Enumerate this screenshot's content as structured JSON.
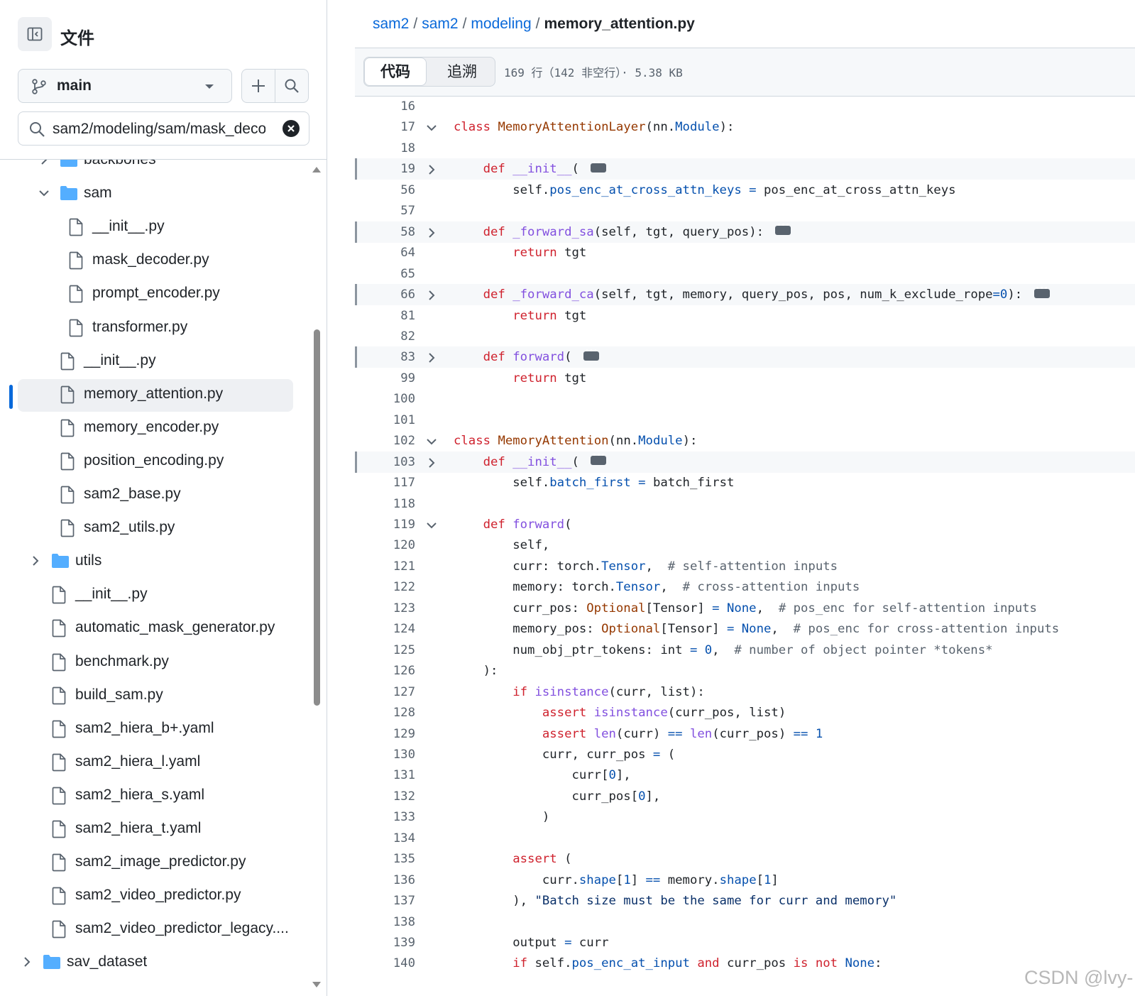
{
  "sidebar": {
    "title": "文件",
    "branch": "main",
    "path_filter": "sam2/modeling/sam/mask_deco",
    "tree": [
      {
        "label": "backbones",
        "type": "folder",
        "expanded": false,
        "depth": 1
      },
      {
        "label": "sam",
        "type": "folder",
        "expanded": true,
        "depth": 1
      },
      {
        "label": "__init__.py",
        "type": "file",
        "depth": 2
      },
      {
        "label": "mask_decoder.py",
        "type": "file",
        "depth": 2
      },
      {
        "label": "prompt_encoder.py",
        "type": "file",
        "depth": 2
      },
      {
        "label": "transformer.py",
        "type": "file",
        "depth": 2
      },
      {
        "label": "__init__.py",
        "type": "file",
        "depth": 1
      },
      {
        "label": "memory_attention.py",
        "type": "file",
        "depth": 1,
        "selected": true
      },
      {
        "label": "memory_encoder.py",
        "type": "file",
        "depth": 1
      },
      {
        "label": "position_encoding.py",
        "type": "file",
        "depth": 1
      },
      {
        "label": "sam2_base.py",
        "type": "file",
        "depth": 1
      },
      {
        "label": "sam2_utils.py",
        "type": "file",
        "depth": 1
      },
      {
        "label": "utils",
        "type": "folder",
        "expanded": false,
        "depth": 0
      },
      {
        "label": "__init__.py",
        "type": "file",
        "depth": 0
      },
      {
        "label": "automatic_mask_generator.py",
        "type": "file",
        "depth": 0
      },
      {
        "label": "benchmark.py",
        "type": "file",
        "depth": 0
      },
      {
        "label": "build_sam.py",
        "type": "file",
        "depth": 0
      },
      {
        "label": "sam2_hiera_b+.yaml",
        "type": "file",
        "depth": 0
      },
      {
        "label": "sam2_hiera_l.yaml",
        "type": "file",
        "depth": 0
      },
      {
        "label": "sam2_hiera_s.yaml",
        "type": "file",
        "depth": 0
      },
      {
        "label": "sam2_hiera_t.yaml",
        "type": "file",
        "depth": 0
      },
      {
        "label": "sam2_image_predictor.py",
        "type": "file",
        "depth": 0
      },
      {
        "label": "sam2_video_predictor.py",
        "type": "file",
        "depth": 0
      },
      {
        "label": "sam2_video_predictor_legacy....",
        "type": "file",
        "depth": 0
      },
      {
        "label": "sav_dataset",
        "type": "folder",
        "expanded": false,
        "depth": -1
      }
    ]
  },
  "breadcrumb": {
    "parts": [
      "sam2",
      "sam2",
      "modeling"
    ],
    "separator": "/",
    "current": "memory_attention.py"
  },
  "toolbar": {
    "tab_code": "代码",
    "tab_blame": "追溯",
    "file_info": "169 行（142 非空行）· 5.38 KB"
  },
  "code": {
    "lines": [
      {
        "n": "16",
        "fold": "",
        "tokens": []
      },
      {
        "n": "17",
        "fold": "down",
        "tokens": [
          [
            "k",
            "class "
          ],
          [
            "t",
            "MemoryAttentionLayer"
          ],
          [
            "",
            "(nn."
          ],
          [
            "n",
            "Module"
          ],
          [
            "",
            "):"
          ]
        ]
      },
      {
        "n": "18",
        "fold": "",
        "tokens": []
      },
      {
        "n": "19",
        "fold": "right",
        "collapsed": true,
        "tokens": [
          [
            "",
            "    "
          ],
          [
            "k",
            "def "
          ],
          [
            "f",
            "__init__"
          ],
          [
            "",
            "( "
          ]
        ]
      },
      {
        "n": "56",
        "fold": "",
        "tokens": [
          [
            "",
            "        self."
          ],
          [
            "n",
            "pos_enc_at_cross_attn_keys"
          ],
          [
            "n",
            " = "
          ],
          [
            "",
            "pos_enc_at_cross_attn_keys"
          ]
        ]
      },
      {
        "n": "57",
        "fold": "",
        "tokens": []
      },
      {
        "n": "58",
        "fold": "right",
        "collapsed": true,
        "tokens": [
          [
            "",
            "    "
          ],
          [
            "k",
            "def "
          ],
          [
            "f",
            "_forward_sa"
          ],
          [
            "",
            "(self, tgt, query_pos): "
          ]
        ]
      },
      {
        "n": "64",
        "fold": "",
        "tokens": [
          [
            "",
            "        "
          ],
          [
            "k",
            "return"
          ],
          [
            "",
            " tgt"
          ]
        ]
      },
      {
        "n": "65",
        "fold": "",
        "tokens": []
      },
      {
        "n": "66",
        "fold": "right",
        "collapsed": true,
        "tokens": [
          [
            "",
            "    "
          ],
          [
            "k",
            "def "
          ],
          [
            "f",
            "_forward_ca"
          ],
          [
            "",
            "(self, tgt, memory, query_pos, pos, num_k_exclude_rope"
          ],
          [
            "n",
            "=0"
          ],
          [
            "",
            "): "
          ]
        ]
      },
      {
        "n": "81",
        "fold": "",
        "tokens": [
          [
            "",
            "        "
          ],
          [
            "k",
            "return"
          ],
          [
            "",
            " tgt"
          ]
        ]
      },
      {
        "n": "82",
        "fold": "",
        "tokens": []
      },
      {
        "n": "83",
        "fold": "right",
        "collapsed": true,
        "tokens": [
          [
            "",
            "    "
          ],
          [
            "k",
            "def "
          ],
          [
            "f",
            "forward"
          ],
          [
            "",
            "( "
          ]
        ]
      },
      {
        "n": "99",
        "fold": "",
        "tokens": [
          [
            "",
            "        "
          ],
          [
            "k",
            "return"
          ],
          [
            "",
            " tgt"
          ]
        ]
      },
      {
        "n": "100",
        "fold": "",
        "tokens": []
      },
      {
        "n": "101",
        "fold": "",
        "tokens": []
      },
      {
        "n": "102",
        "fold": "down",
        "tokens": [
          [
            "k",
            "class "
          ],
          [
            "t",
            "MemoryAttention"
          ],
          [
            "",
            "(nn."
          ],
          [
            "n",
            "Module"
          ],
          [
            "",
            "):"
          ]
        ]
      },
      {
        "n": "103",
        "fold": "right",
        "collapsed": true,
        "tokens": [
          [
            "",
            "    "
          ],
          [
            "k",
            "def "
          ],
          [
            "f",
            "__init__"
          ],
          [
            "",
            "( "
          ]
        ]
      },
      {
        "n": "117",
        "fold": "",
        "tokens": [
          [
            "",
            "        self."
          ],
          [
            "n",
            "batch_first"
          ],
          [
            "n",
            " = "
          ],
          [
            "",
            "batch_first"
          ]
        ]
      },
      {
        "n": "118",
        "fold": "",
        "tokens": []
      },
      {
        "n": "119",
        "fold": "down",
        "tokens": [
          [
            "",
            "    "
          ],
          [
            "k",
            "def "
          ],
          [
            "f",
            "forward"
          ],
          [
            "",
            "("
          ]
        ]
      },
      {
        "n": "120",
        "fold": "",
        "tokens": [
          [
            "",
            "        self,"
          ]
        ]
      },
      {
        "n": "121",
        "fold": "",
        "tokens": [
          [
            "",
            "        curr: torch."
          ],
          [
            "n",
            "Tensor"
          ],
          [
            "",
            ",  "
          ],
          [
            "c",
            "# self-attention inputs"
          ]
        ]
      },
      {
        "n": "122",
        "fold": "",
        "tokens": [
          [
            "",
            "        memory: torch."
          ],
          [
            "n",
            "Tensor"
          ],
          [
            "",
            ",  "
          ],
          [
            "c",
            "# cross-attention inputs"
          ]
        ]
      },
      {
        "n": "123",
        "fold": "",
        "tokens": [
          [
            "",
            "        curr_pos: "
          ],
          [
            "t",
            "Optional"
          ],
          [
            "",
            "[Tensor] "
          ],
          [
            "n",
            "= None"
          ],
          [
            "",
            ",  "
          ],
          [
            "c",
            "# pos_enc for self-attention inputs"
          ]
        ]
      },
      {
        "n": "124",
        "fold": "",
        "tokens": [
          [
            "",
            "        memory_pos: "
          ],
          [
            "t",
            "Optional"
          ],
          [
            "",
            "[Tensor] "
          ],
          [
            "n",
            "= None"
          ],
          [
            "",
            ",  "
          ],
          [
            "c",
            "# pos_enc for cross-attention inputs"
          ]
        ]
      },
      {
        "n": "125",
        "fold": "",
        "tokens": [
          [
            "",
            "        num_obj_ptr_tokens: int "
          ],
          [
            "n",
            "= 0"
          ],
          [
            "",
            ",  "
          ],
          [
            "c",
            "# number of object pointer *tokens*"
          ]
        ]
      },
      {
        "n": "126",
        "fold": "",
        "tokens": [
          [
            "",
            "    ):"
          ]
        ]
      },
      {
        "n": "127",
        "fold": "",
        "tokens": [
          [
            "",
            "        "
          ],
          [
            "k",
            "if "
          ],
          [
            "f",
            "isinstance"
          ],
          [
            "",
            "(curr, list):"
          ]
        ]
      },
      {
        "n": "128",
        "fold": "",
        "tokens": [
          [
            "",
            "            "
          ],
          [
            "k",
            "assert "
          ],
          [
            "f",
            "isinstance"
          ],
          [
            "",
            "(curr_pos, list)"
          ]
        ]
      },
      {
        "n": "129",
        "fold": "",
        "tokens": [
          [
            "",
            "            "
          ],
          [
            "k",
            "assert "
          ],
          [
            "f",
            "len"
          ],
          [
            "",
            "(curr) "
          ],
          [
            "n",
            "=="
          ],
          [
            "",
            " "
          ],
          [
            "f",
            "len"
          ],
          [
            "",
            "(curr_pos) "
          ],
          [
            "n",
            "== 1"
          ]
        ]
      },
      {
        "n": "130",
        "fold": "",
        "tokens": [
          [
            "",
            "            curr, curr_pos "
          ],
          [
            "n",
            "="
          ],
          [
            "",
            " ("
          ]
        ]
      },
      {
        "n": "131",
        "fold": "",
        "tokens": [
          [
            "",
            "                curr["
          ],
          [
            "n",
            "0"
          ],
          [
            "",
            "],"
          ]
        ]
      },
      {
        "n": "132",
        "fold": "",
        "tokens": [
          [
            "",
            "                curr_pos["
          ],
          [
            "n",
            "0"
          ],
          [
            "",
            "],"
          ]
        ]
      },
      {
        "n": "133",
        "fold": "",
        "tokens": [
          [
            "",
            "            )"
          ]
        ]
      },
      {
        "n": "134",
        "fold": "",
        "tokens": []
      },
      {
        "n": "135",
        "fold": "",
        "tokens": [
          [
            "",
            "        "
          ],
          [
            "k",
            "assert"
          ],
          [
            "",
            " ("
          ]
        ]
      },
      {
        "n": "136",
        "fold": "",
        "tokens": [
          [
            "",
            "            curr."
          ],
          [
            "n",
            "shape"
          ],
          [
            "",
            "["
          ],
          [
            "n",
            "1"
          ],
          [
            "",
            "] "
          ],
          [
            "n",
            "=="
          ],
          [
            "",
            " memory."
          ],
          [
            "n",
            "shape"
          ],
          [
            "",
            "["
          ],
          [
            "n",
            "1"
          ],
          [
            "",
            "]"
          ]
        ]
      },
      {
        "n": "137",
        "fold": "",
        "tokens": [
          [
            "",
            "        ), "
          ],
          [
            "s",
            "\"Batch size must be the same for curr and memory\""
          ]
        ]
      },
      {
        "n": "138",
        "fold": "",
        "tokens": []
      },
      {
        "n": "139",
        "fold": "",
        "tokens": [
          [
            "",
            "        output "
          ],
          [
            "n",
            "="
          ],
          [
            "",
            " curr"
          ]
        ]
      },
      {
        "n": "140",
        "fold": "",
        "tokens": [
          [
            "",
            "        "
          ],
          [
            "k",
            "if"
          ],
          [
            "",
            " self."
          ],
          [
            "n",
            "pos_enc_at_input"
          ],
          [
            "",
            " "
          ],
          [
            "k",
            "and"
          ],
          [
            "",
            " curr_pos "
          ],
          [
            "k",
            "is not"
          ],
          [
            "",
            " "
          ],
          [
            "n",
            "None"
          ],
          [
            "",
            ":"
          ]
        ]
      }
    ]
  },
  "watermark": "CSDN @lvy-"
}
